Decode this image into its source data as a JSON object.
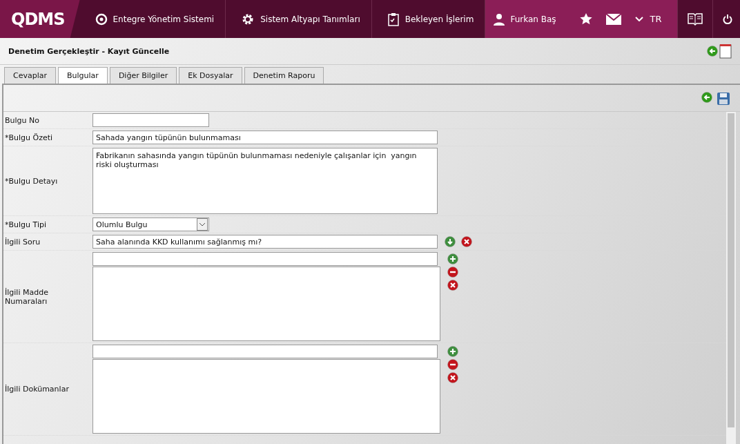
{
  "topbar": {
    "logo": "QDMS",
    "nav": [
      {
        "label": "Entegre Yönetim Sistemi"
      },
      {
        "label": "Sistem Altyapı Tanımları"
      },
      {
        "label": "Bekleyen İşlerim"
      }
    ],
    "user": "Furkan Baş",
    "language": "TR"
  },
  "page_title": "Denetim Gerçekleştir - Kayıt Güncelle",
  "tabs": [
    {
      "label": "Cevaplar",
      "selected": false
    },
    {
      "label": "Bulgular",
      "selected": true
    },
    {
      "label": "Diğer Bilgiler",
      "selected": false
    },
    {
      "label": "Ek Dosyalar",
      "selected": false
    },
    {
      "label": "Denetim Raporu",
      "selected": false
    }
  ],
  "fields": [
    {
      "kind": "short",
      "label": "Bulgu No"
    },
    {
      "kind": "text",
      "label": "*Bulgu Özeti",
      "value": "Sahada yangın tüpünün bulunmaması"
    },
    {
      "kind": "textarea",
      "label": "*Bulgu Detayı",
      "value": "Fabrikanın sahasında yangın tüpünün bulunmaması nedeniyle çalışanlar için  yangın riski oluşturması"
    },
    {
      "kind": "select",
      "label": "*Bulgu Tipi",
      "value": "Olumlu Bulgu"
    },
    {
      "kind": "lookup",
      "label": "İlgili Soru",
      "value": "Saha alanında KKD kullanımı sağlanmış mı?"
    },
    {
      "kind": "list",
      "label": "İlgili Madde Numaraları"
    },
    {
      "kind": "list",
      "label": "İlgili Dokümanlar"
    }
  ]
}
